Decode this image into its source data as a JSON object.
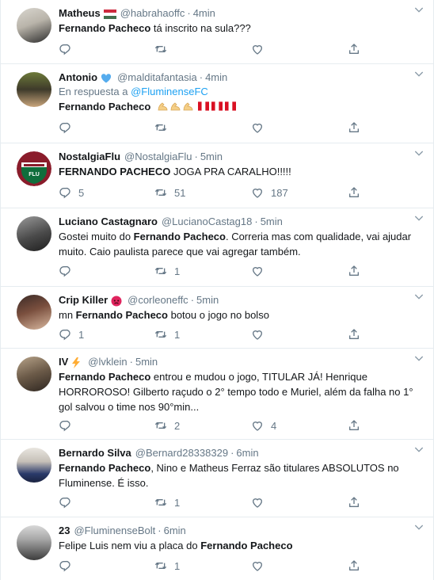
{
  "tweets": [
    {
      "name": "Matheus",
      "badge": "hungary-flag-badge",
      "handle": "@habrahaoffc",
      "time": "4min",
      "reply_prefix": "",
      "reply_to": "",
      "text_bold": "Fernando Pacheco",
      "text_rest": " tá inscrito na sula???",
      "replies": "",
      "retweets": "",
      "likes": ""
    },
    {
      "name": "Antonio",
      "badge": "blue-heart-badge",
      "handle": "@malditafantasia",
      "time": "4min",
      "reply_prefix": "En respuesta a ",
      "reply_to": "@FluminenseFC",
      "text_bold": "Fernando Pacheco",
      "text_rest": "",
      "replies": "",
      "retweets": "",
      "likes": ""
    },
    {
      "name": "NostalgiaFlu",
      "badge": "",
      "handle": "@NostalgiaFlu",
      "time": "5min",
      "reply_prefix": "",
      "reply_to": "",
      "text_bold": "FERNANDO PACHECO",
      "text_rest": " JOGA PRA CARALHO!!!!!",
      "replies": "5",
      "retweets": "51",
      "likes": "187"
    },
    {
      "name": "Luciano Castagnaro",
      "badge": "",
      "handle": "@LucianoCastag18",
      "time": "5min",
      "reply_prefix": "",
      "reply_to": "",
      "text_pre": "Gostei muito do ",
      "text_bold": "Fernando Pacheco",
      "text_rest": ". Correria mas com qualidade, vai ajudar muito. Caio paulista parece que vai agregar também.",
      "replies": "",
      "retweets": "1",
      "likes": ""
    },
    {
      "name": "Crip Killer",
      "badge": "angry-face-badge",
      "handle": "@corleoneffc",
      "time": "5min",
      "reply_prefix": "",
      "reply_to": "",
      "text_pre": "mn ",
      "text_bold": "Fernando Pacheco",
      "text_rest": " botou o jogo no bolso",
      "replies": "1",
      "retweets": "1",
      "likes": ""
    },
    {
      "name": "IV",
      "badge": "lightning-badge",
      "handle": "@lvklein",
      "time": "5min",
      "reply_prefix": "",
      "reply_to": "",
      "text_bold": "Fernando Pacheco",
      "text_rest": " entrou e mudou o jogo, TITULAR JÁ! Henrique HORROROSO! Gilberto raçudo o 2° tempo todo e Muriel, além da falha no 1° gol salvou o time nos 90°min...",
      "replies": "",
      "retweets": "2",
      "likes": "4"
    },
    {
      "name": "Bernardo Silva",
      "badge": "",
      "handle": "@Bernard28338329",
      "time": "6min",
      "reply_prefix": "",
      "reply_to": "",
      "text_bold": "Fernando Pacheco",
      "text_rest": ", Nino e Matheus Ferraz são titulares ABSOLUTOS no Fluminense. É isso.",
      "replies": "",
      "retweets": "1",
      "likes": ""
    },
    {
      "name": "23",
      "badge": "",
      "handle": "@FluminenseBolt",
      "time": "6min",
      "reply_prefix": "",
      "reply_to": "",
      "text_pre": "Felipe Luis nem viu a placa do ",
      "text_bold": "Fernando Pacheco",
      "text_rest": "",
      "replies": "",
      "retweets": "1",
      "likes": ""
    }
  ],
  "icons": {
    "reply": "reply-icon",
    "retweet": "retweet-icon",
    "like": "heart-icon",
    "share": "share-icon",
    "more": "chevron-down-icon"
  },
  "colors": {
    "link": "#1da1f2",
    "muted": "#657786",
    "text": "#14171a",
    "border": "#e6ecf0"
  }
}
